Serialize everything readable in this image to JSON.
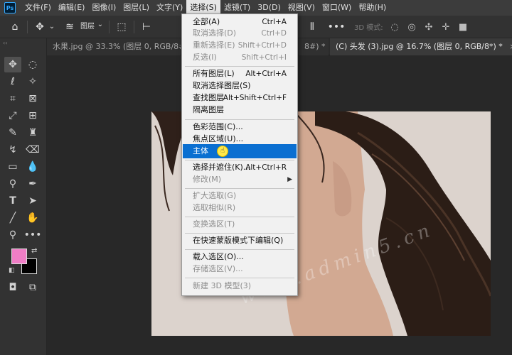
{
  "app": {
    "logo": "Ps"
  },
  "menubar": {
    "items": [
      "文件(F)",
      "编辑(E)",
      "图像(I)",
      "图层(L)",
      "文字(Y)",
      "选择(S)",
      "滤镜(T)",
      "3D(D)",
      "视图(V)",
      "窗口(W)",
      "帮助(H)"
    ],
    "active_index": 5
  },
  "options_bar": {
    "layer_select": "图层",
    "mode_3d_label": "3D 模式:"
  },
  "tabs": [
    {
      "label": "水果.jpg @ 33.3% (图层 0, RGB/8#) *",
      "active": false
    },
    {
      "label": "(C) 头发 (3).jpg @ 16.7% (图层 0, RGB/8*) *",
      "active": true
    }
  ],
  "tab_close_glyph": "×",
  "tab_partial_text": "8#) *",
  "select_menu": {
    "items": [
      {
        "label": "全部(A)",
        "shortcut": "Ctrl+A",
        "disabled": false
      },
      {
        "label": "取消选择(D)",
        "shortcut": "Ctrl+D",
        "disabled": true
      },
      {
        "label": "重新选择(E)",
        "shortcut": "Shift+Ctrl+D",
        "disabled": true
      },
      {
        "label": "反选(I)",
        "shortcut": "Shift+Ctrl+I",
        "disabled": true
      },
      {
        "label": "所有图层(L)",
        "shortcut": "Alt+Ctrl+A",
        "disabled": false
      },
      {
        "label": "取消选择图层(S)",
        "shortcut": "",
        "disabled": false
      },
      {
        "label": "查找图层",
        "shortcut": "Alt+Shift+Ctrl+F",
        "disabled": false
      },
      {
        "label": "隔离图层",
        "shortcut": "",
        "disabled": false
      },
      {
        "label": "色彩范围(C)...",
        "shortcut": "",
        "disabled": false
      },
      {
        "label": "焦点区域(U)...",
        "shortcut": "",
        "disabled": false
      },
      {
        "label": "主体",
        "shortcut": "",
        "disabled": false,
        "highlighted": true
      },
      {
        "label": "选择并遮住(K)...",
        "shortcut": "Alt+Ctrl+R",
        "disabled": false
      },
      {
        "label": "修改(M)",
        "shortcut": "",
        "disabled": true,
        "submenu": true
      },
      {
        "label": "扩大选取(G)",
        "shortcut": "",
        "disabled": true
      },
      {
        "label": "选取相似(R)",
        "shortcut": "",
        "disabled": true
      },
      {
        "label": "变换选区(T)",
        "shortcut": "",
        "disabled": true
      },
      {
        "label": "在快速蒙版模式下编辑(Q)",
        "shortcut": "",
        "disabled": false
      },
      {
        "label": "载入选区(O)...",
        "shortcut": "",
        "disabled": false
      },
      {
        "label": "存储选区(V)...",
        "shortcut": "",
        "disabled": true
      },
      {
        "label": "新建 3D 模型(3)",
        "shortcut": "",
        "disabled": true
      }
    ]
  },
  "colors": {
    "foreground": "#f07ec6",
    "background": "#000000",
    "highlight": "#0a6fd1"
  },
  "watermark": "www.admin5.cn"
}
